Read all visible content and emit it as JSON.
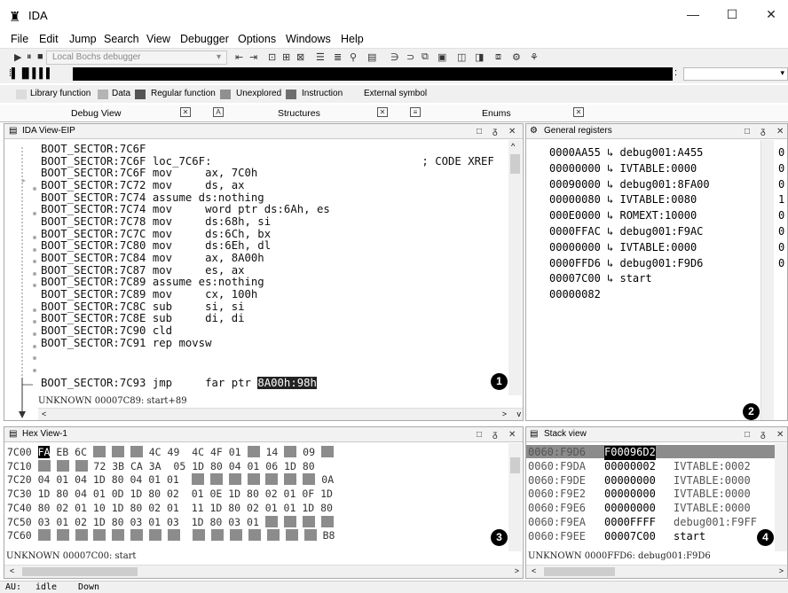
{
  "window": {
    "title": "IDA",
    "minimize": "—",
    "maximize": "☐",
    "close": "✕"
  },
  "menu": [
    "File",
    "Edit",
    "Jump",
    "Search",
    "View",
    "Debugger",
    "Options",
    "Windows",
    "Help"
  ],
  "toolbar": {
    "debugger": "Local Bochs debugger"
  },
  "legend": [
    "Library function",
    "Data",
    "Regular function",
    "Unexplored",
    "Instruction",
    "External symbol"
  ],
  "legend_colors": {
    "library": "#dcdcdc",
    "data": "#b4b4b4",
    "regular": "#555555",
    "unexplored": "#909090",
    "instruction": "#6e6e6e"
  },
  "tabs": [
    "Debug View",
    "Structures",
    "Enums"
  ],
  "ida_view": {
    "title": "IDA View-EIP",
    "lines": [
      "BOOT_SECTOR:7C6F",
      "BOOT_SECTOR:7C6F loc_7C6F:                                ; CODE XREF",
      "BOOT_SECTOR:7C6F mov     ax, 7C0h",
      "BOOT_SECTOR:7C72 mov     ds, ax",
      "BOOT_SECTOR:7C74 assume ds:nothing",
      "BOOT_SECTOR:7C74 mov     word ptr ds:6Ah, es",
      "BOOT_SECTOR:7C78 mov     ds:68h, si",
      "BOOT_SECTOR:7C7C mov     ds:6Ch, bx",
      "BOOT_SECTOR:7C80 mov     ds:6Eh, dl",
      "BOOT_SECTOR:7C84 mov     ax, 8A00h",
      "BOOT_SECTOR:7C87 mov     es, ax",
      "BOOT_SECTOR:7C89 assume es:nothing",
      "BOOT_SECTOR:7C89 mov     cx, 100h",
      "BOOT_SECTOR:7C8C sub     si, si",
      "BOOT_SECTOR:7C8E sub     di, di",
      "BOOT_SECTOR:7C90 cld",
      "BOOT_SECTOR:7C91 rep movsw"
    ],
    "last_line_prefix": "BOOT_SECTOR:7C93 jmp     far ptr ",
    "last_line_highlight": "8A00h:98h",
    "status": "UNKNOWN 00007C89: start+89",
    "badge": "1"
  },
  "registers": {
    "title": "General registers",
    "rows": [
      "0000AA55 ↳ debug001:A455",
      "00000000 ↳ IVTABLE:0000",
      "00090000 ↳ debug001:8FA00",
      "00000080 ↳ IVTABLE:0080",
      "000E0000 ↳ ROMEXT:10000",
      "0000FFAC ↳ debug001:F9AC",
      "00000000 ↳ IVTABLE:0000",
      "0000FFD6 ↳ debug001:F9D6",
      "00007C00 ↳ start",
      "00000082"
    ],
    "flags": [
      "0",
      "0",
      "0",
      "1",
      "0",
      "0",
      "0",
      "0"
    ],
    "badge": "2"
  },
  "hex_view": {
    "title": "Hex View-1",
    "status": "UNKNOWN 00007C00: start",
    "badge": "3"
  },
  "stack_view": {
    "title": "Stack view",
    "rows": [
      {
        "addr": "0060:F9D6",
        "value": "F00096D2",
        "comment": ""
      },
      {
        "addr": "0060:F9DA",
        "value": "00000002",
        "comment": "IVTABLE:0002"
      },
      {
        "addr": "0060:F9DE",
        "value": "00000000",
        "comment": "IVTABLE:0000"
      },
      {
        "addr": "0060:F9E2",
        "value": "00000000",
        "comment": "IVTABLE:0000"
      },
      {
        "addr": "0060:F9E6",
        "value": "00000000",
        "comment": "IVTABLE:0000"
      },
      {
        "addr": "0060:F9EA",
        "value": "0000FFFF",
        "comment": "debug001:F9FF"
      },
      {
        "addr": "0060:F9EE",
        "value": "00007C00",
        "comment": "start"
      }
    ],
    "status": "UNKNOWN 0000FFD6: debug001:F9D6",
    "badge": "4"
  },
  "statusbar": {
    "au": "AU:",
    "state": "idle",
    "dir": "Down"
  }
}
